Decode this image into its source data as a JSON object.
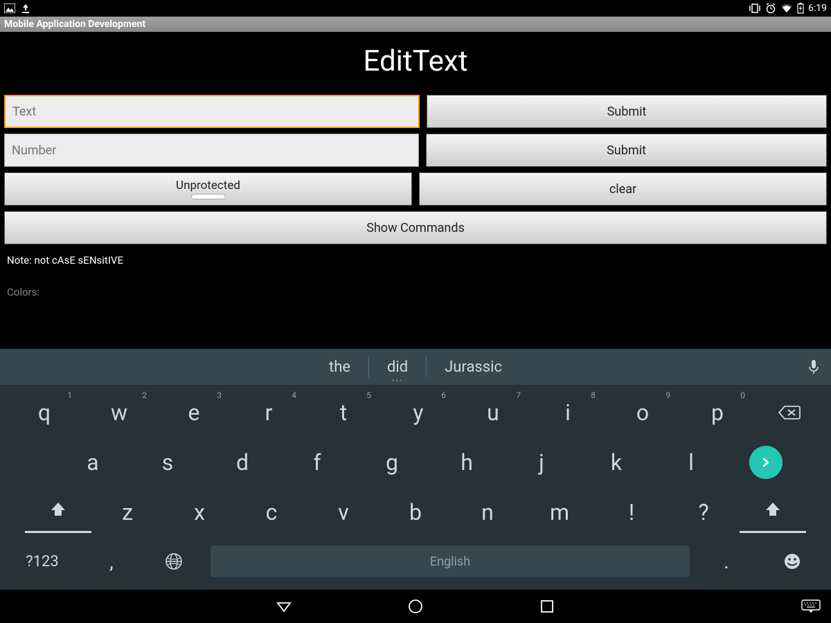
{
  "status": {
    "time": "6:19"
  },
  "app": {
    "title": "Mobile Application Development"
  },
  "page": {
    "heading": "EditText",
    "text_placeholder": "Text",
    "number_placeholder": "Number",
    "submit_label": "Submit",
    "toggle_label": "Unprotected",
    "clear_label": "clear",
    "show_commands_label": "Show Commands",
    "note": "Note: not cAsE sENsitIVE",
    "colors_label": "Colors:"
  },
  "ime": {
    "suggestions": [
      "the",
      "did",
      "Jurassic"
    ],
    "row1": [
      {
        "k": "q",
        "h": "1"
      },
      {
        "k": "w",
        "h": "2"
      },
      {
        "k": "e",
        "h": "3"
      },
      {
        "k": "r",
        "h": "4"
      },
      {
        "k": "t",
        "h": "5"
      },
      {
        "k": "y",
        "h": "6"
      },
      {
        "k": "u",
        "h": "7"
      },
      {
        "k": "i",
        "h": "8"
      },
      {
        "k": "o",
        "h": "9"
      },
      {
        "k": "p",
        "h": "0"
      }
    ],
    "row2": [
      "a",
      "s",
      "d",
      "f",
      "g",
      "h",
      "j",
      "k",
      "l"
    ],
    "row3": [
      "z",
      "x",
      "c",
      "v",
      "b",
      "n",
      "m",
      "!",
      "?"
    ],
    "symbols_label": "?123",
    "space_label": "English",
    "comma": ","
  },
  "colors": {
    "accent": "#26c6b4",
    "focus": "#ff9900"
  }
}
